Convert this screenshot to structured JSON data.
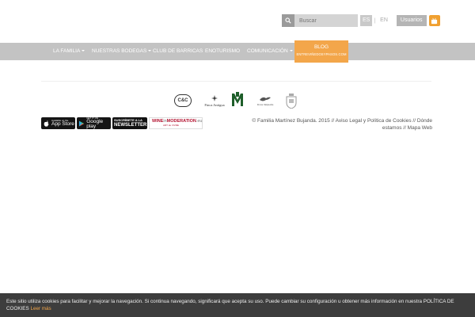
{
  "search": {
    "placeholder": "Buscar"
  },
  "lang": {
    "es": "ES",
    "separator": "|",
    "en": "EN"
  },
  "users_label": "Usuarios",
  "nav": {
    "items": [
      {
        "label": "LA FAMILIA",
        "dropdown": true
      },
      {
        "label": "NUESTRAS BODEGAS",
        "dropdown": true
      },
      {
        "label": "CLUB DE BARRICAS",
        "dropdown": false
      },
      {
        "label": "ENOTURISMO",
        "dropdown": false
      },
      {
        "label": "COMUNICACIÓN",
        "dropdown": true
      }
    ],
    "blog_title": "BLOG",
    "blog_subtitle": "ENTREVIÑEDOSYPASOS.COM"
  },
  "logos": {
    "cc": "C&C",
    "finca": "Finca Antigua",
    "valjunco": "Finca Valpiedra"
  },
  "badges": {
    "appstore_top": "Available on the",
    "appstore": "App Store",
    "googleplay_top": "GET IT ON",
    "googleplay": "Google play",
    "newsletter_top": "SUSCRÍBETE A LA",
    "newsletter": "NEWSLETTER",
    "wim_a": "WINE",
    "wim_b": "in",
    "wim_c": "MODERATION",
    "wim_d": ".eu",
    "wim_e": "ART de VIVRE"
  },
  "footer": {
    "copyright": "© Familia Martínez Bujanda. 2015 // Aviso Legal y Política de Cookies // Dónde estamos // Mapa Web"
  },
  "cookie": {
    "text": "Este sitio utiliza cookies para facilitar y mejorar la navegación. Si continua navegando, significará que acepta su uso. Puede cambiar su configuración u obtener más información en nuestra POLÍTICA DE COOKIES",
    "more": "Leer más"
  },
  "colors": {
    "accent": "#f3a64a",
    "nav_bg": "#c3c3c3",
    "cookie_bg": "#3d3d3d"
  }
}
